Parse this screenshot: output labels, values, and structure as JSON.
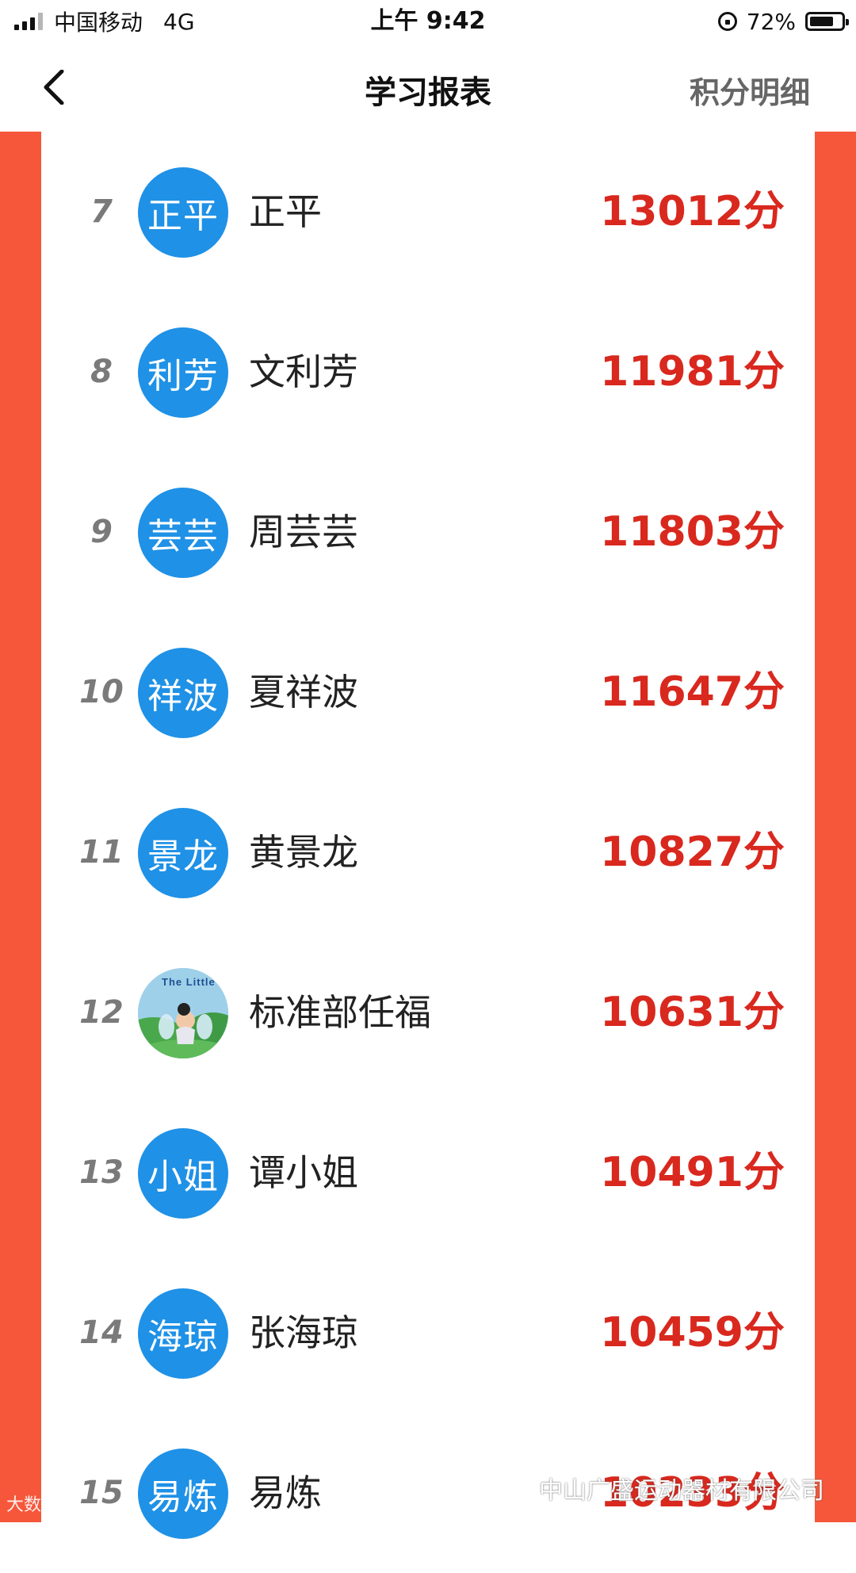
{
  "status_bar": {
    "carrier": "中国移动",
    "network": "4G",
    "time": "上午 9:42",
    "battery": "72%"
  },
  "nav": {
    "title": "学习报表",
    "right_link": "积分明细"
  },
  "rows": [
    {
      "rank": "7",
      "avatar_text": "正平",
      "name": "正平",
      "score": "13012分"
    },
    {
      "rank": "8",
      "avatar_text": "利芳",
      "name": "文利芳",
      "score": "11981分"
    },
    {
      "rank": "9",
      "avatar_text": "芸芸",
      "name": "周芸芸",
      "score": "11803分"
    },
    {
      "rank": "10",
      "avatar_text": "祥波",
      "name": "夏祥波",
      "score": "11647分"
    },
    {
      "rank": "11",
      "avatar_text": "景龙",
      "name": "黄景龙",
      "score": "10827分"
    },
    {
      "rank": "12",
      "avatar_image_text": "The Little Fairy",
      "name": "标准部任福",
      "score": "10631分"
    },
    {
      "rank": "13",
      "avatar_text": "小姐",
      "name": "谭小姐",
      "score": "10491分"
    },
    {
      "rank": "14",
      "avatar_text": "海琼",
      "name": "张海琼",
      "score": "10459分"
    },
    {
      "rank": "15",
      "avatar_text": "易炼",
      "name": "易炼",
      "score": "10233分"
    }
  ],
  "watermarks": {
    "left": "大数跨境",
    "right": "中山广盛运动器材有限公司"
  },
  "colors": {
    "accent_red": "#f6573b",
    "score_red": "#d9281e",
    "avatar_blue": "#1f91e6"
  }
}
